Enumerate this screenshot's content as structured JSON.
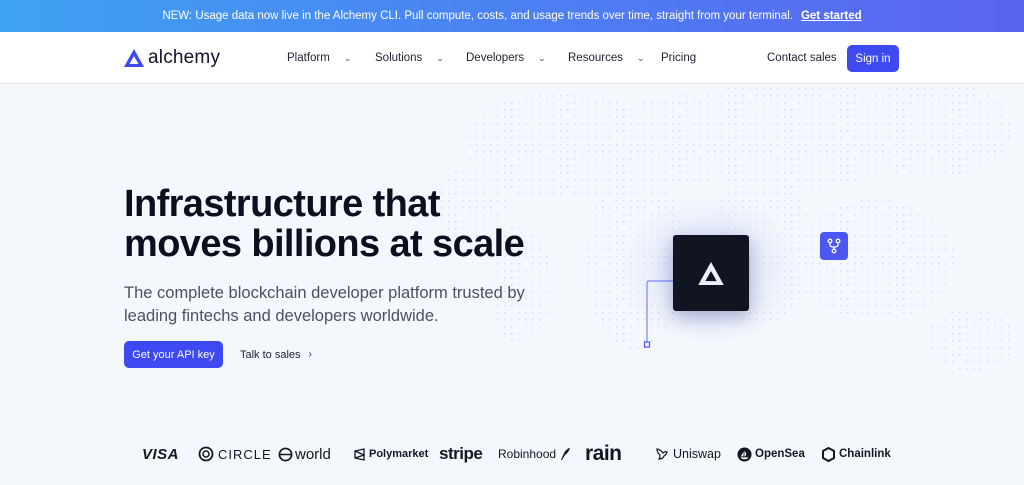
{
  "banner": {
    "text": "NEW: Usage data now live in the Alchemy CLI. Pull compute, costs, and usage trends over time, straight from your terminal.",
    "cta": "Get started"
  },
  "nav": {
    "logo_text": "alchemy",
    "items": [
      {
        "label": "Platform",
        "has_dropdown": true
      },
      {
        "label": "Solutions",
        "has_dropdown": true
      },
      {
        "label": "Developers",
        "has_dropdown": true
      },
      {
        "label": "Resources",
        "has_dropdown": true
      },
      {
        "label": "Pricing",
        "has_dropdown": false
      }
    ],
    "contact": "Contact sales",
    "signin": "Sign in"
  },
  "hero": {
    "headline_line1": "Infrastructure that",
    "headline_line2": "moves billions at scale",
    "subtitle_line1": "The complete blockchain developer platform trusted by",
    "subtitle_line2": "leading fintechs and developers worldwide.",
    "primary_cta": "Get your API key",
    "secondary_cta": "Talk to sales",
    "chip_icon": "alchemy-logo-icon",
    "branch_icon": "git-branch-icon"
  },
  "partners": [
    {
      "name": "VISA",
      "icon": "visa-logo"
    },
    {
      "name": "CIRCLE",
      "icon": "circle-logo-icon"
    },
    {
      "name": "world",
      "icon": "world-logo-icon"
    },
    {
      "name": "Polymarket",
      "icon": "polymarket-logo-icon"
    },
    {
      "name": "stripe",
      "icon": "stripe-logo"
    },
    {
      "name": "Robinhood",
      "icon": "robinhood-feather-icon"
    },
    {
      "name": "rain",
      "icon": "rain-logo"
    },
    {
      "name": "Uniswap",
      "icon": "uniswap-unicorn-icon"
    },
    {
      "name": "OpenSea",
      "icon": "opensea-logo-icon"
    },
    {
      "name": "Chainlink",
      "icon": "chainlink-hexagon-icon"
    }
  ],
  "colors": {
    "accent": "#3f49f1",
    "background": "#f4f7fb",
    "banner_start": "#3fa2f3",
    "banner_end": "#5b63f0",
    "chip": "#111522"
  }
}
